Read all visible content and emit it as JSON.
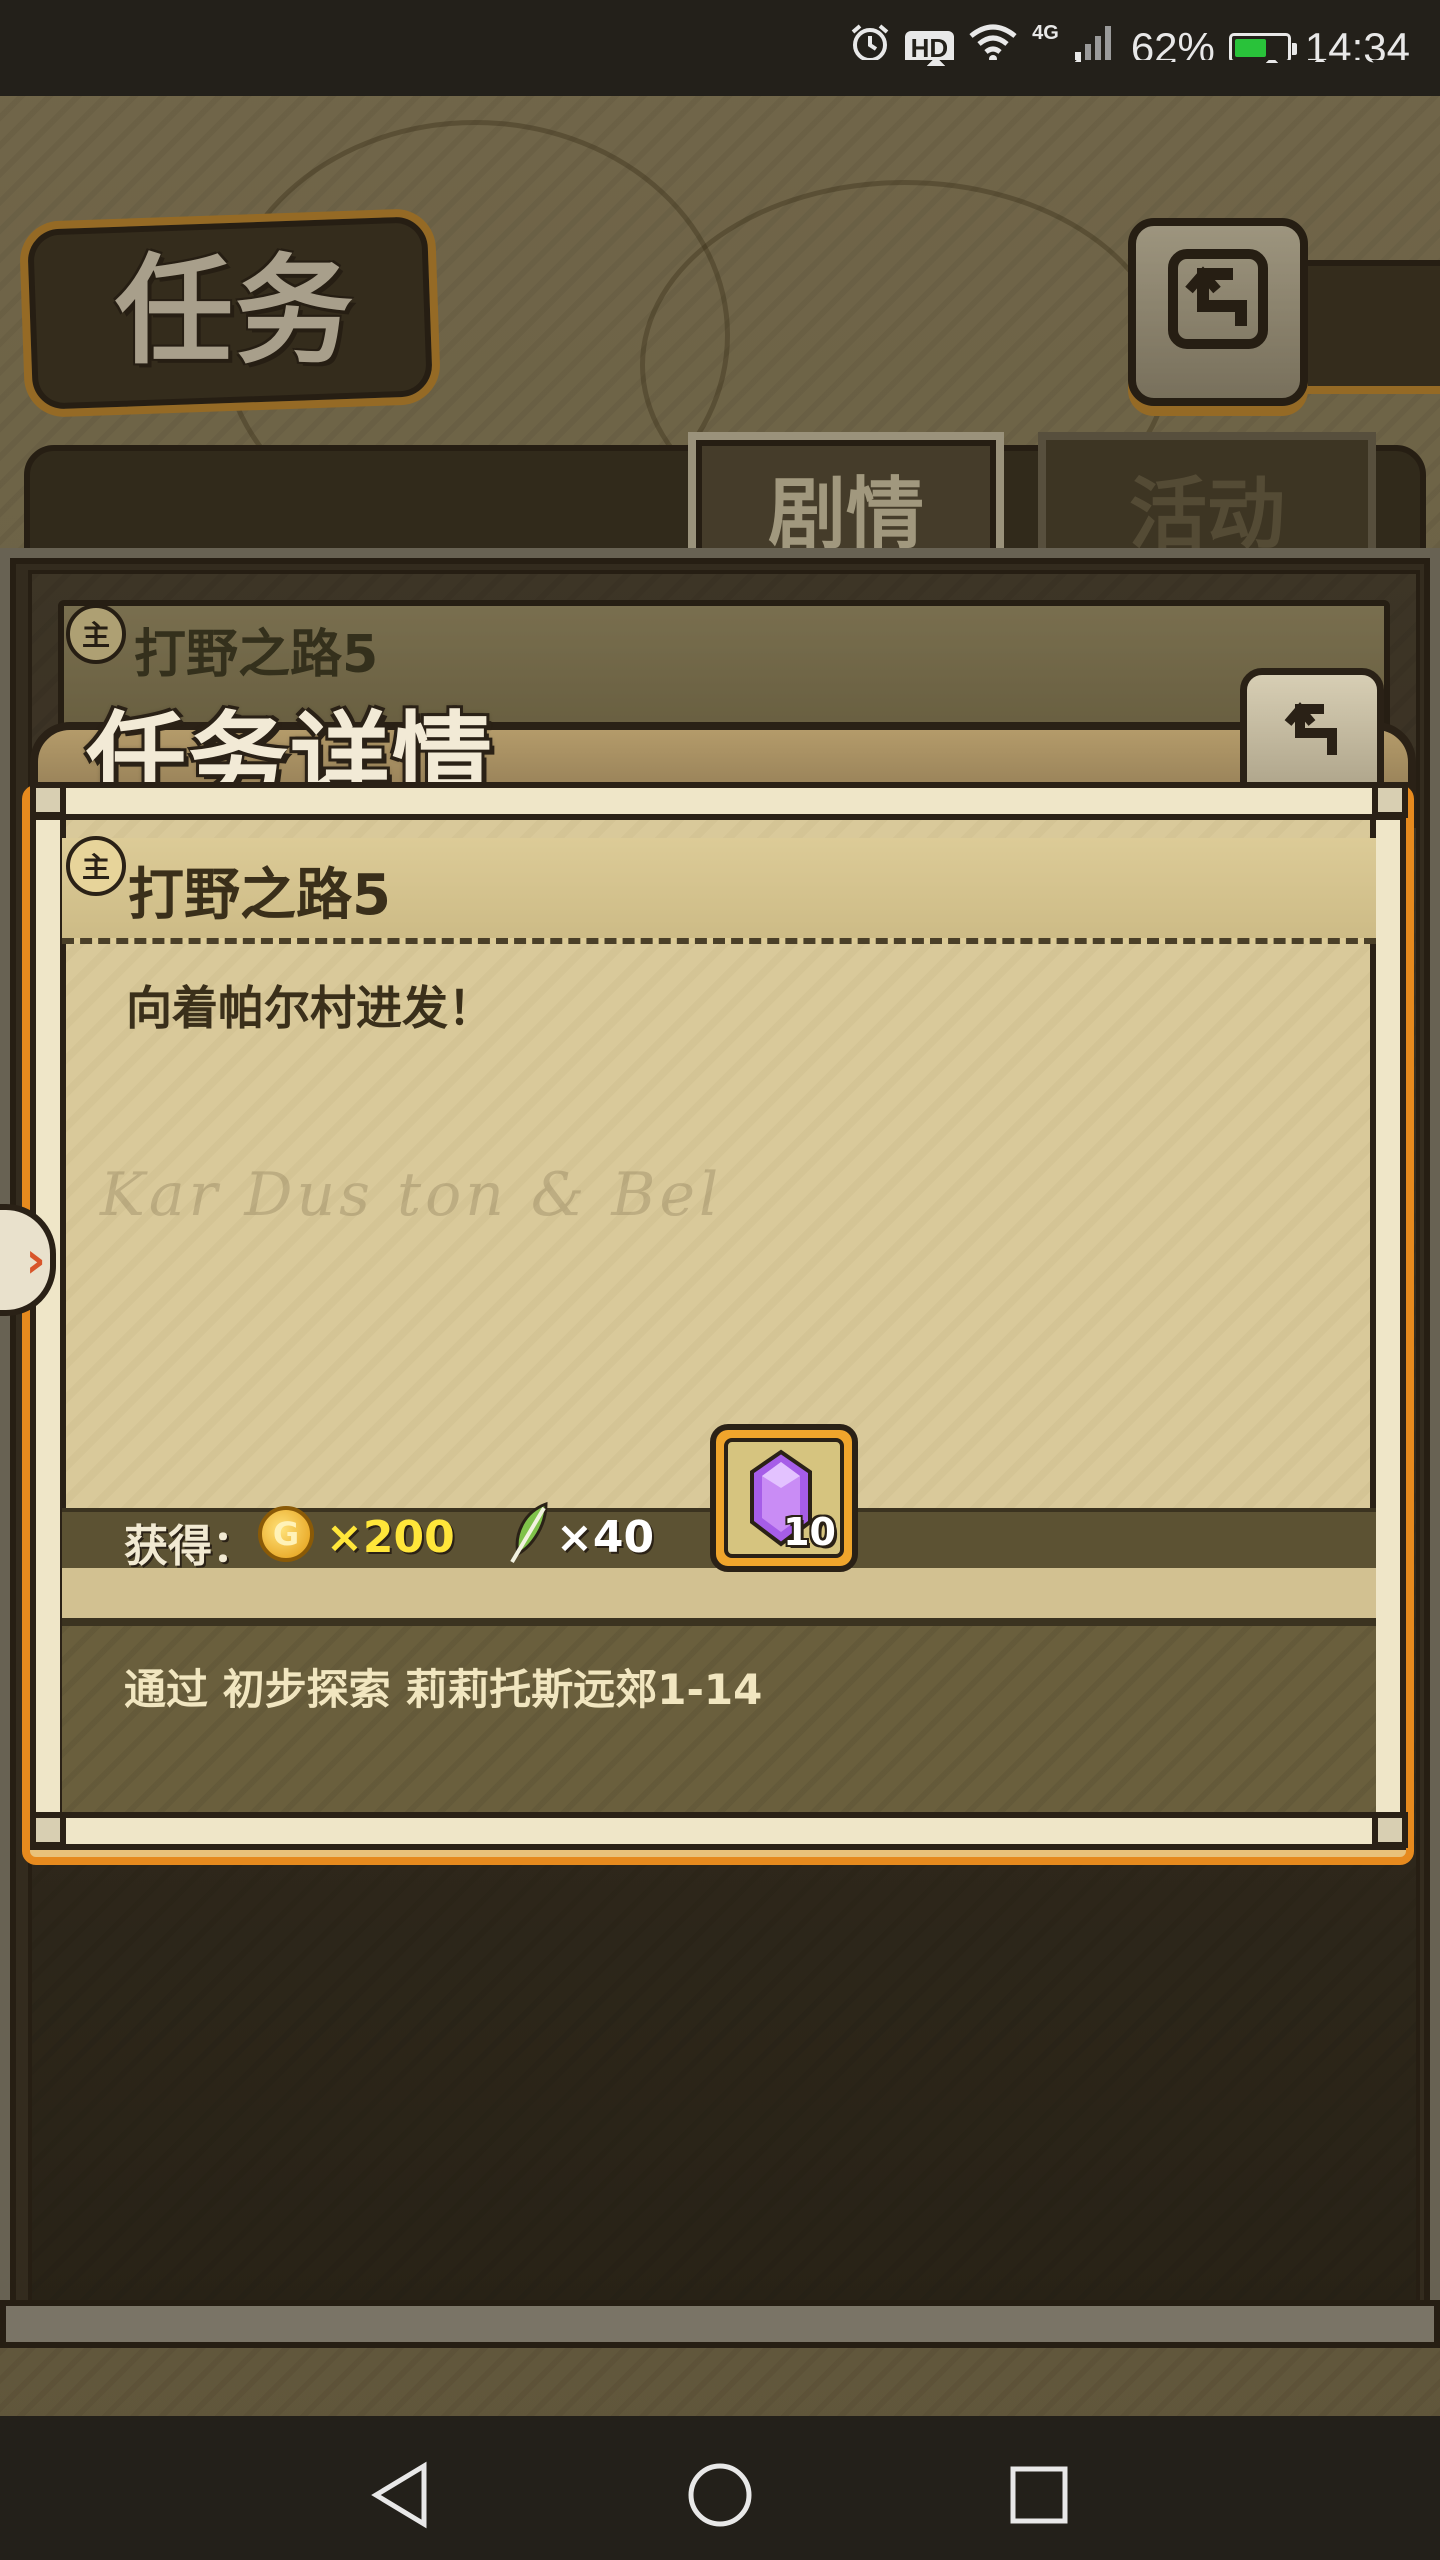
{
  "status_bar": {
    "battery_percent": "62%",
    "battery_level": 0.62,
    "time": "14:34",
    "hd_label": "HD",
    "network_label": "4G",
    "icons": [
      "alarm-icon",
      "hd-icon",
      "wifi-icon",
      "signal-icon",
      "battery-icon"
    ]
  },
  "header": {
    "title": "任务",
    "back_icon": "return-arrow-icon"
  },
  "tabs": [
    {
      "label": "剧情",
      "active": true
    },
    {
      "label": "活动",
      "active": false
    }
  ],
  "list": {
    "items": [
      {
        "badge": "主",
        "name": "打野之路5"
      }
    ]
  },
  "dialog": {
    "title": "任务详情",
    "quest_badge": "主",
    "quest_name": "打野之路5",
    "description": "向着帕尔村进发！",
    "reward_label": "获得：",
    "coin_symbol": "G",
    "gold_amount": "×200",
    "feather_amount": "×40",
    "crystal_count": "10",
    "condition": "通过 初步探索 莉莉托斯远郊1-14"
  },
  "colors": {
    "accent_orange": "#e68a1e",
    "gold_text": "#ffe63a",
    "crystal_purple": "#a65de8"
  }
}
